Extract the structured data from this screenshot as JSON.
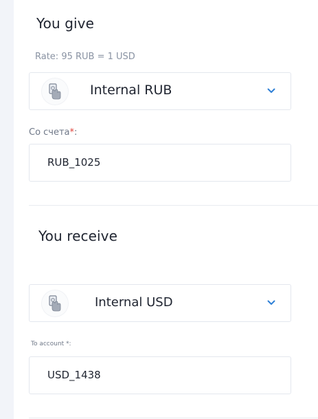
{
  "give": {
    "title": "You give",
    "rate": "Rate: 95 RUB = 1 USD",
    "select": {
      "label": "Internal RUB",
      "icon": "hand-card-icon"
    },
    "account_label": "Со счета",
    "required_mark": "*",
    "account_label_suffix": ":",
    "account_value": "RUB_1025"
  },
  "receive": {
    "title": "You receive",
    "select": {
      "label": "Internal USD",
      "icon": "hand-card-icon"
    },
    "account_label": "To account *:",
    "account_value": "USD_1438"
  },
  "colors": {
    "accent_chevron": "#2f80d6",
    "required": "#e0443c",
    "border": "#e3e7ee"
  }
}
